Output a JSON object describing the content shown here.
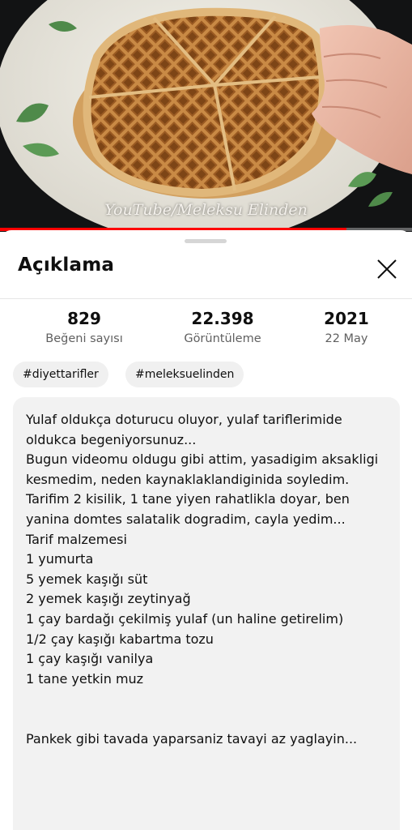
{
  "video": {
    "watermark": "YouTube/Meleksu Elinden",
    "progress_fraction": 0.84,
    "colors": {
      "progress": "#ff0000"
    }
  },
  "sheet": {
    "title": "Açıklama",
    "close_icon": "close-icon",
    "stats": [
      {
        "value": "829",
        "label": "Beğeni sayısı"
      },
      {
        "value": "22.398",
        "label": "Görüntüleme"
      },
      {
        "value": "2021",
        "label": "22 May"
      }
    ],
    "hashtags": [
      "#diyettarifler",
      "#meleksuelinden"
    ],
    "description": "Yulaf oldukça doturucu oluyor, yulaf tariflerimide oldukca begeniyorsunuz...\nBugun videomu oldugu gibi attim, yasadigim aksakligi kesmedim, neden kaynaklaklandiginida soyledim.\nTarifim 2 kisilik, 1 tane yiyen rahatlikla doyar, ben yanina domtes salatalik dogradim, cayla yedim...\nTarif malzemesi\n1 yumurta\n5 yemek kaşığı süt\n2 yemek kaşığı zeytinyağ\n1 çay bardağı çekilmiş yulaf (un haline getirelim)\n1/2 çay kaşığı kabartma tozu\n1 çay kaşığı vanilya\n1 tane yetkin muz\n\n\nPankek gibi tavada yaparsaniz tavayi az yaglayin..."
  }
}
